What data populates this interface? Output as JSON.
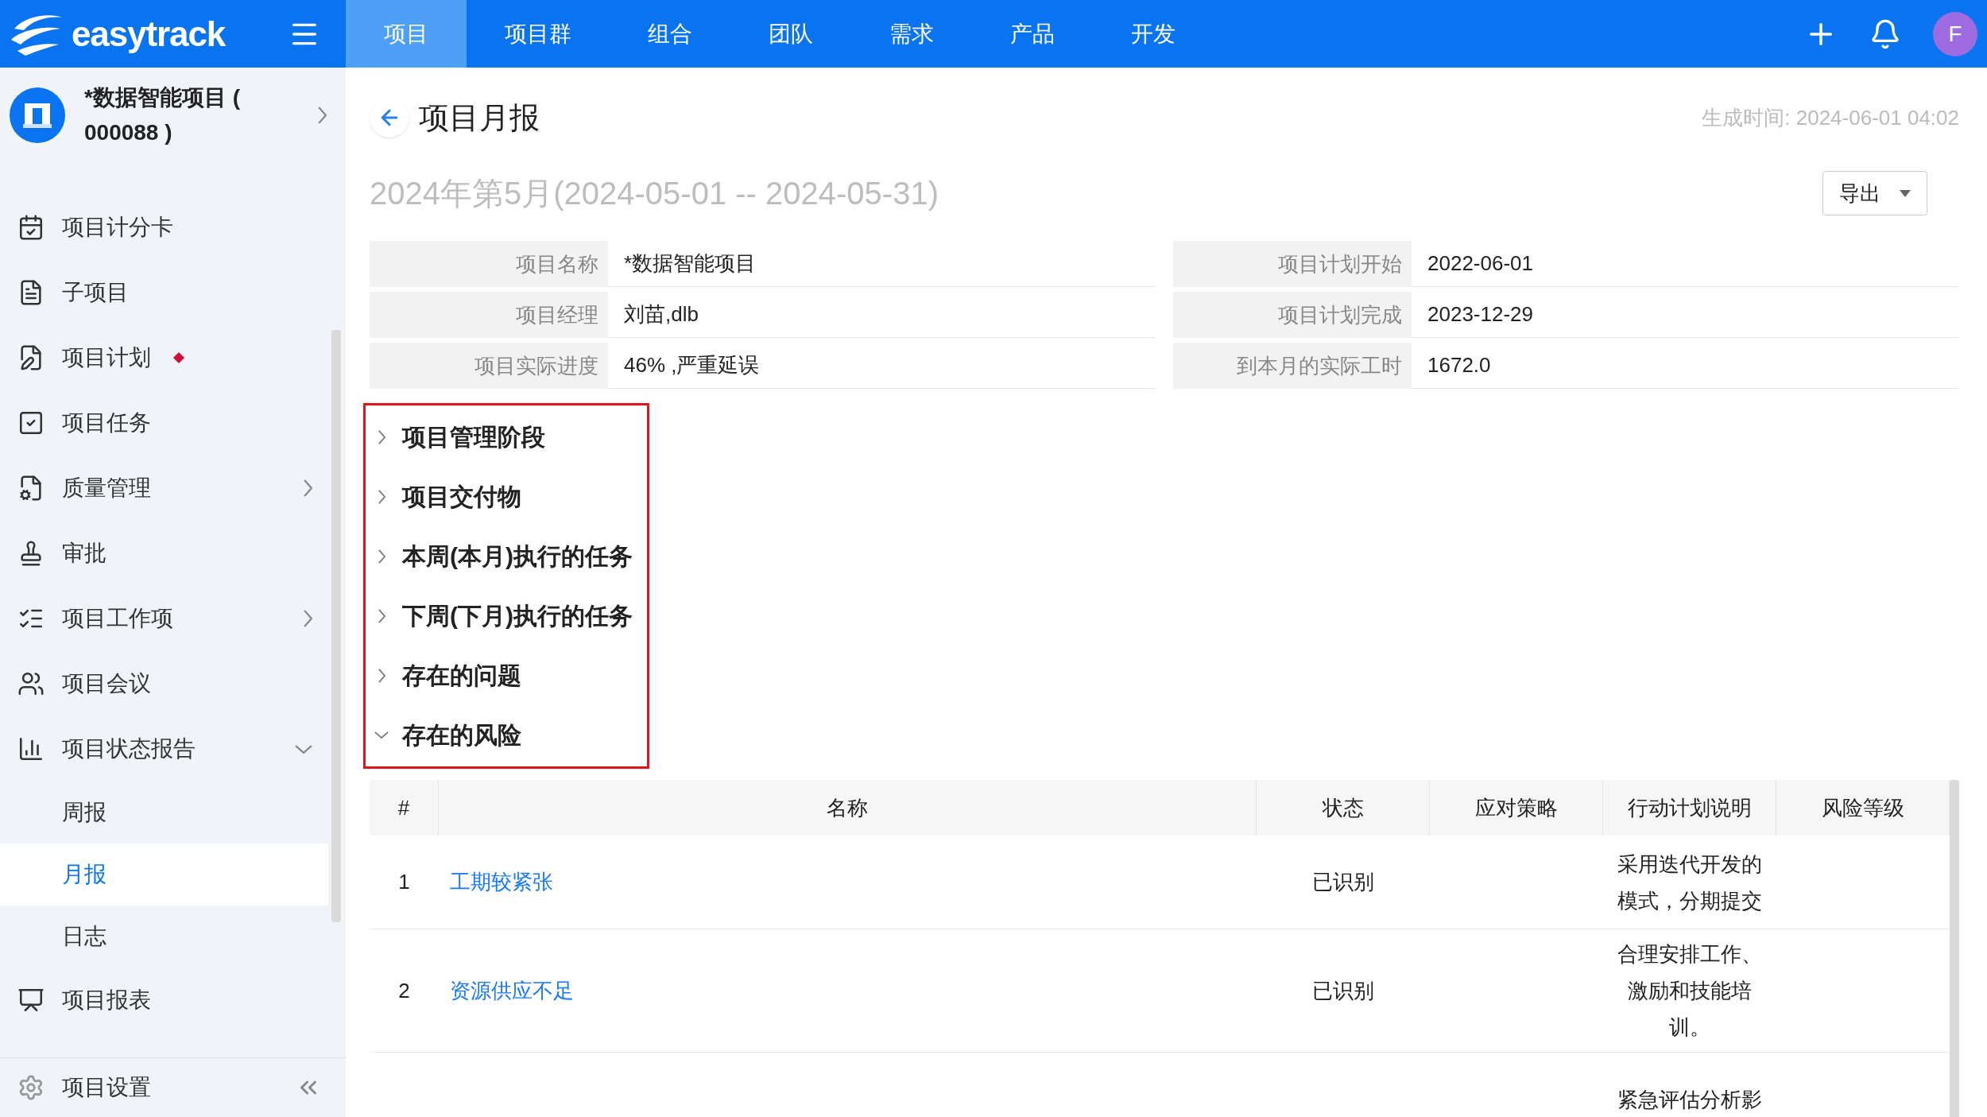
{
  "app": {
    "logo": "easytrack",
    "avatar": "F"
  },
  "top_nav": [
    {
      "label": "项目",
      "selected": true
    },
    {
      "label": "项目群",
      "selected": false
    },
    {
      "label": "组合",
      "selected": false
    },
    {
      "label": "团队",
      "selected": false
    },
    {
      "label": "需求",
      "selected": false
    },
    {
      "label": "产品",
      "selected": false
    },
    {
      "label": "开发",
      "selected": false
    }
  ],
  "project": {
    "name": "*数据智能项目 ( 000088 )"
  },
  "sidebar": {
    "items": [
      {
        "label": "项目计分卡",
        "kind": "plain"
      },
      {
        "label": "子项目",
        "kind": "plain"
      },
      {
        "label": "项目计划",
        "kind": "plain",
        "flagged": true
      },
      {
        "label": "项目任务",
        "kind": "plain"
      },
      {
        "label": "质量管理",
        "kind": "group",
        "expanded": false
      },
      {
        "label": "审批",
        "kind": "plain"
      },
      {
        "label": "项目工作项",
        "kind": "group",
        "expanded": false
      },
      {
        "label": "项目会议",
        "kind": "plain"
      },
      {
        "label": "项目状态报告",
        "kind": "group",
        "expanded": true,
        "children": [
          {
            "label": "周报",
            "selected": false
          },
          {
            "label": "月报",
            "selected": true
          },
          {
            "label": "日志",
            "selected": false
          }
        ]
      },
      {
        "label": "项目报表",
        "kind": "plain"
      }
    ],
    "footer": "项目设置"
  },
  "page": {
    "title": "项目月报",
    "generated": "生成时间: 2024-06-01 04:02",
    "period": "2024年第5月(2024-05-01 -- 2024-05-31)",
    "export_button": "导出"
  },
  "info": [
    {
      "label": "项目名称",
      "value": "*数据智能项目"
    },
    {
      "label": "项目计划开始",
      "value": "2022-06-01"
    },
    {
      "label": "项目经理",
      "value": "刘苗,dlb"
    },
    {
      "label": "项目计划完成",
      "value": "2023-12-29"
    },
    {
      "label": "项目实际进度",
      "value": "46% ,严重延误"
    },
    {
      "label": "到本月的实际工时",
      "value": "1672.0"
    }
  ],
  "sections": [
    {
      "label": "项目管理阶段",
      "expanded": false
    },
    {
      "label": "项目交付物",
      "expanded": false
    },
    {
      "label": "本周(本月)执行的任务",
      "expanded": false
    },
    {
      "label": "下周(下月)执行的任务",
      "expanded": false
    },
    {
      "label": "存在的问题",
      "expanded": false
    },
    {
      "label": "存在的风险",
      "expanded": true
    }
  ],
  "risk_table": {
    "columns": [
      "#",
      "名称",
      "状态",
      "应对策略",
      "行动计划说明",
      "风险等级"
    ],
    "rows": [
      {
        "number": "1",
        "name": "工期较紧张",
        "status": "已识别",
        "action_plan": "采用迭代开发的模式，分期提交"
      },
      {
        "number": "2",
        "name": "资源供应不足",
        "status": "已识别",
        "action_plan": "合理安排工作、激励和技能培训。"
      },
      {
        "action_plan": "紧急评估分析影"
      }
    ]
  }
}
